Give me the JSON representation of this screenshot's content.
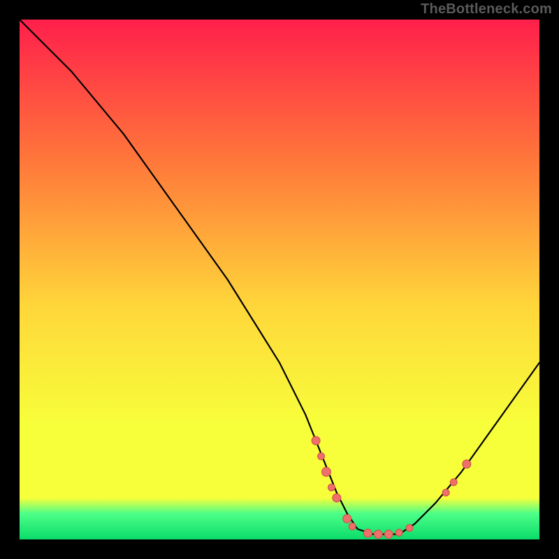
{
  "attribution": "TheBottleneck.com",
  "colors": {
    "gradient_top": "#ff1f4b",
    "gradient_mid_upper": "#ff7a3a",
    "gradient_mid": "#ffd63a",
    "gradient_lower": "#f7ff3a",
    "gradient_bottom_band": "#4dff88",
    "gradient_bottom": "#0bdc6a",
    "curve": "#000000",
    "marker_fill": "#ef6f6a",
    "marker_stroke": "#c94e49",
    "frame": "#000000"
  },
  "chart_data": {
    "type": "line",
    "title": "",
    "xlabel": "",
    "ylabel": "",
    "xlim": [
      0,
      100
    ],
    "ylim": [
      0,
      100
    ],
    "series": [
      {
        "name": "bottleneck-curve",
        "x": [
          0,
          3,
          6,
          10,
          15,
          20,
          25,
          30,
          35,
          40,
          45,
          50,
          55,
          57,
          59,
          61,
          63,
          65,
          68,
          70,
          73,
          76,
          80,
          85,
          90,
          95,
          100
        ],
        "y": [
          100,
          97,
          94,
          90,
          84,
          78,
          71,
          64,
          57,
          50,
          42,
          34,
          24,
          19,
          14,
          9,
          5,
          2,
          1,
          1,
          1,
          3,
          7,
          13,
          20,
          27,
          34
        ]
      }
    ],
    "markers": [
      {
        "x": 57,
        "y": 19,
        "r": 6
      },
      {
        "x": 58,
        "y": 16,
        "r": 5
      },
      {
        "x": 59,
        "y": 13,
        "r": 6.5
      },
      {
        "x": 60,
        "y": 10,
        "r": 5
      },
      {
        "x": 61,
        "y": 8,
        "r": 6
      },
      {
        "x": 63,
        "y": 4,
        "r": 6
      },
      {
        "x": 64,
        "y": 2.5,
        "r": 5
      },
      {
        "x": 67,
        "y": 1.2,
        "r": 6
      },
      {
        "x": 69,
        "y": 1,
        "r": 6
      },
      {
        "x": 71,
        "y": 1,
        "r": 6
      },
      {
        "x": 73,
        "y": 1.3,
        "r": 5
      },
      {
        "x": 75,
        "y": 2.2,
        "r": 5
      },
      {
        "x": 82,
        "y": 9,
        "r": 5
      },
      {
        "x": 83.5,
        "y": 11,
        "r": 5
      },
      {
        "x": 86,
        "y": 14.5,
        "r": 6
      }
    ],
    "bands": [
      {
        "name": "green-band",
        "y_from": 0,
        "y_to": 4,
        "color": "gradient_bottom"
      },
      {
        "name": "light-green-band",
        "y_from": 4,
        "y_to": 7,
        "color": "gradient_bottom_band"
      }
    ]
  }
}
